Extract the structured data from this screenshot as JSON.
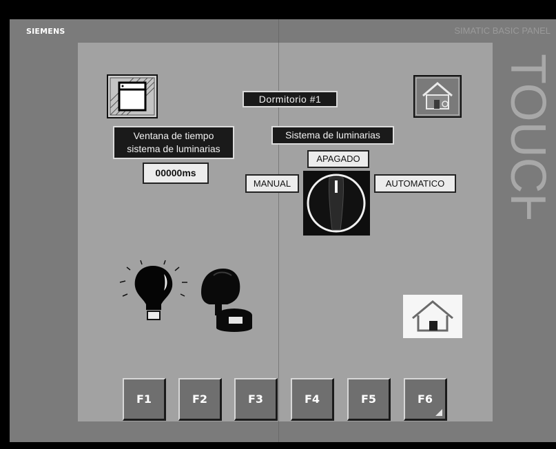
{
  "panel": {
    "brand": "SIEMENS",
    "model": "SIMATIC BASIC PANEL",
    "touch_label": "TOUCH"
  },
  "screen": {
    "title": "Dormitorio #1",
    "time_window": {
      "line1": "Ventana de tiempo",
      "line2": "sistema  de luminarias",
      "value": "00000ms"
    },
    "lighting": {
      "title": "Sistema de luminarias",
      "state_off": "APAGADO",
      "mode_manual": "MANUAL",
      "mode_auto": "AUTOMATICO"
    },
    "icons": {
      "left_button": "window-icon",
      "top_right": "house-settings-icon",
      "selector": "selector-switch-icon",
      "lamp": "light-bulb-icon",
      "sensor": "motion-sensor-icon",
      "home": "home-icon"
    }
  },
  "function_keys": [
    "F1",
    "F2",
    "F3",
    "F4",
    "F5",
    "F6"
  ],
  "colors": {
    "bezel": "#7b7b7b",
    "screen_bg": "#a2a2a2",
    "label_dark": "#1a1a1a",
    "label_light": "#ececec"
  }
}
